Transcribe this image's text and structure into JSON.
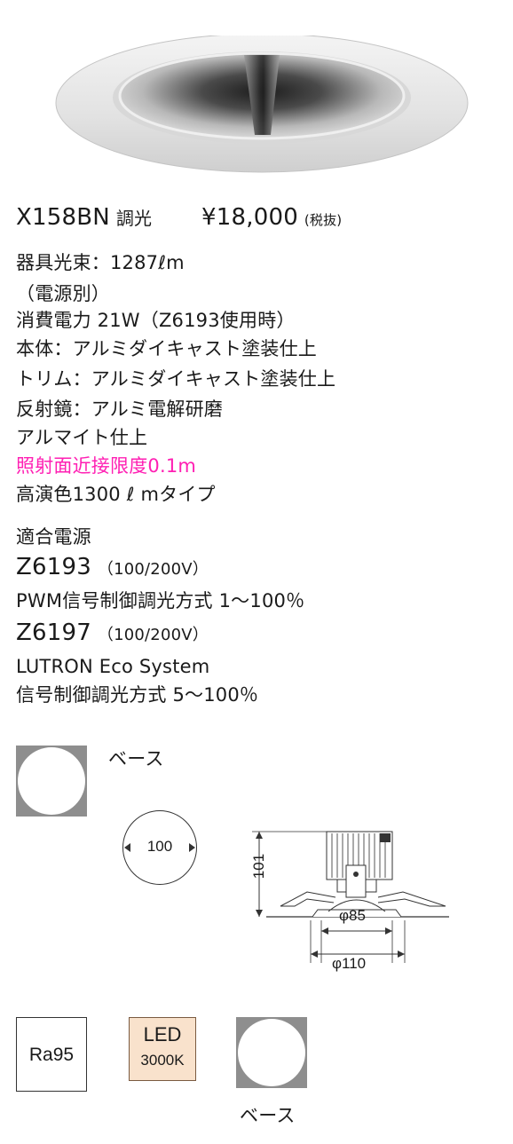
{
  "product": {
    "model_code": "X158BN",
    "model_sub": "調光",
    "price": "¥18,000",
    "price_tax": "(税抜)"
  },
  "specs": {
    "lumen": "器具光束：1287ℓm",
    "power_source": "（電源別）",
    "power": "消費電力 21W（Z6193使用時）",
    "body": "本体：アルミダイキャスト塗装仕上",
    "trim": "トリム：アルミダイキャスト塗装仕上",
    "reflector": "反射鏡：アルミ電解研磨",
    "reflector2": "アルマイト仕上",
    "highlight": "照射面近接限度0.1m",
    "type": "高演色1300 ℓ mタイプ"
  },
  "power_units": {
    "heading": "適合電源",
    "unit1_code": "Z6193",
    "unit1_voltage": "（100/200V）",
    "unit1_desc": "PWM信号制御調光方式 1〜100％",
    "unit2_code": "Z6197",
    "unit2_voltage": "（100/200V）",
    "unit2_desc_line1": "LUTRON Eco System",
    "unit2_desc_line2": "信号制御調光方式 5〜100％"
  },
  "symbols": {
    "base_label_top": "ベース",
    "cutout_size": "100",
    "ra_label": "Ra95",
    "led_label": "LED",
    "led_temp": "3000K",
    "base_label_bottom": "ベース"
  },
  "dimensions": {
    "height": "101",
    "inner_diameter": "φ85",
    "outer_diameter": "φ110"
  },
  "colors": {
    "highlight": "#ff1fb3",
    "symbol_gray": "#8e8e8e",
    "led_fill": "#f9e2cc"
  }
}
